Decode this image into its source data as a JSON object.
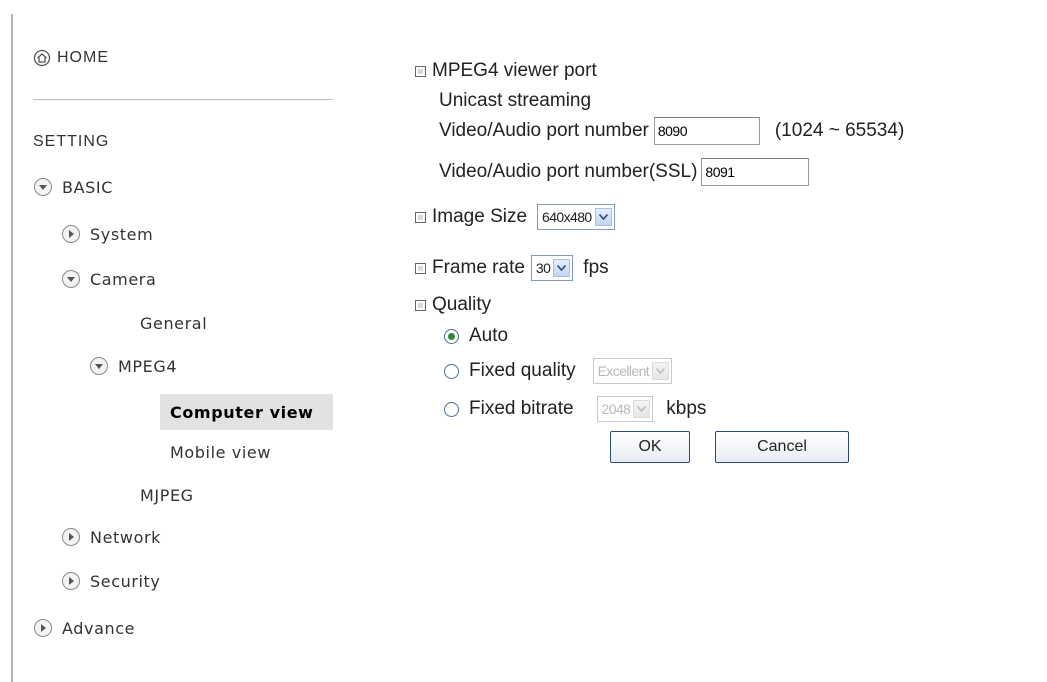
{
  "sidebar": {
    "home": "HOME",
    "setting": "SETTING",
    "basic": "BASIC",
    "system": "System",
    "camera": "Camera",
    "general": "General",
    "mpeg4": "MPEG4",
    "computer_view": "Computer view",
    "mobile_view": "Mobile view",
    "mjpeg": "MJPEG",
    "network": "Network",
    "security": "Security",
    "advance": "Advance"
  },
  "form": {
    "section_title": "MPEG4 viewer port",
    "unicast": "Unicast streaming",
    "va_port_label": "Video/Audio port number",
    "va_port_value": "8090",
    "port_range": "(1024 ~ 65534)",
    "va_ssl_label": "Video/Audio port number(SSL)",
    "va_ssl_value": "8091",
    "image_size_label": "Image Size",
    "image_size_value": "640x480",
    "frame_rate_label": "Frame rate",
    "frame_rate_value": "30",
    "fps": "fps",
    "quality_label": "Quality",
    "auto": "Auto",
    "fixed_quality": "Fixed quality",
    "fixed_quality_value": "Excellent",
    "fixed_bitrate": "Fixed bitrate",
    "fixed_bitrate_value": "2048",
    "kbps": "kbps",
    "ok": "OK",
    "cancel": "Cancel"
  },
  "colors": {
    "radio_checked": "#2e8a32",
    "active_bg": "#e2e2e2"
  }
}
